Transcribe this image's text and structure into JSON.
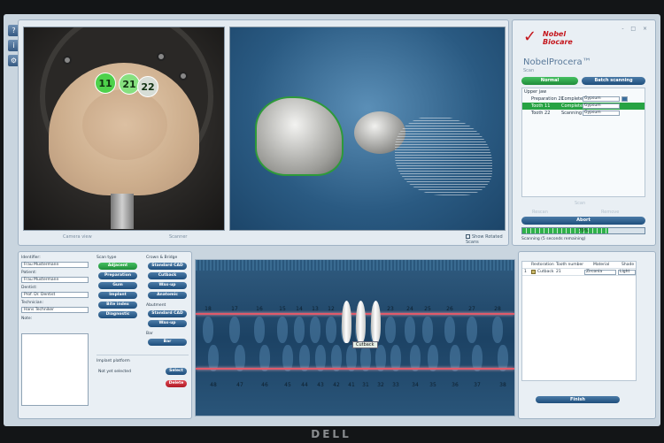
{
  "toolbar": {
    "help": "?",
    "info": "i",
    "settings": "⚙"
  },
  "photo": {
    "badges": [
      "11",
      "21",
      "22"
    ],
    "caption_left": "Camera view",
    "caption_right": "Scanner"
  },
  "scan_view": {
    "show_rotated_scans": "Show Rotated Scans"
  },
  "brand": {
    "logo_line1": "Nobel",
    "logo_line2": "Biocare",
    "product": "NobelProcera™",
    "product_sub": "Scan"
  },
  "window_controls": "- □ ×",
  "modes": {
    "normal": "Normal",
    "batch": "Batch scanning"
  },
  "scan_list": {
    "group": "Upper jaw",
    "rows": [
      {
        "name": "Preparation 21",
        "status": "Completed",
        "material": "Gypsum",
        "selected": false
      },
      {
        "name": "Tooth 11",
        "status": "Completed",
        "material": "Gypsum",
        "selected": true
      },
      {
        "name": "Tooth 22",
        "status": "Scanning",
        "material": "Gypsum",
        "selected": false
      }
    ],
    "faint_buttons": [
      "Scan",
      "Rescan",
      "Remove"
    ]
  },
  "abort_label": "Abort",
  "progress": {
    "value": 0.7,
    "label": "70%"
  },
  "scan_status": "Scanning (5 seconds remaining)",
  "patient": {
    "identifier_label": "Identifier:",
    "identifier": "Frau Mustermann",
    "patient_label": "Patient:",
    "patient": "Frau Mustermann",
    "dentist_label": "Dentist:",
    "dentist": "Prof. Dr. Dentist",
    "technician_label": "Technician:",
    "technician": "Hans Techniker",
    "note_label": "Note:"
  },
  "scan_type": {
    "title": "Scan type",
    "buttons": [
      "Adjacent",
      "Preparation",
      "Gum",
      "Implant",
      "Bite index",
      "Diagnostic"
    ],
    "active": "Adjacent"
  },
  "crown_bridge": {
    "title": "Crown & Bridge",
    "buttons": [
      "Standard CAD",
      "Cutback",
      "Wax-up",
      "Anatomic"
    ]
  },
  "abutment": {
    "title": "Abutment",
    "buttons": [
      "Standard CAD",
      "Wax-up"
    ]
  },
  "bar": {
    "title": "Bar",
    "button": "Bar"
  },
  "implant_platform": {
    "title": "Implant platform",
    "value": "Not yet selected",
    "select": "Select",
    "delete": "Delete"
  },
  "dental_chart": {
    "upper": [
      "18",
      "17",
      "16",
      "15",
      "14",
      "13",
      "12",
      "11",
      "21",
      "22",
      "23",
      "24",
      "25",
      "26",
      "27",
      "28"
    ],
    "lower": [
      "48",
      "47",
      "46",
      "45",
      "44",
      "43",
      "42",
      "41",
      "31",
      "32",
      "33",
      "34",
      "35",
      "36",
      "37",
      "38"
    ],
    "selected": [
      "11",
      "21",
      "22"
    ],
    "tag": "Cutback"
  },
  "restorations": {
    "headers": [
      "Restoration",
      "Tooth number",
      "Material",
      "Shade"
    ],
    "rows": [
      {
        "index": "1",
        "restoration": "Cutback",
        "tooth": "21",
        "material": "Zirconia",
        "shade": "Light"
      }
    ]
  },
  "finish_label": "Finish",
  "monitor_brand": "DELL"
}
